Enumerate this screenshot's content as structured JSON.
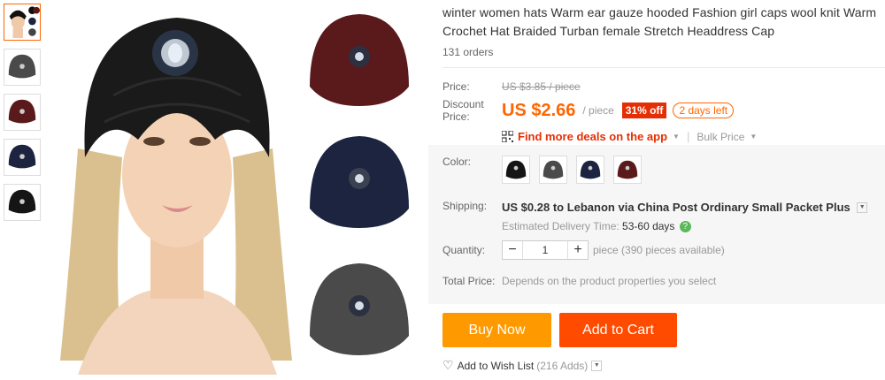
{
  "product": {
    "title": "winter women hats Warm ear gauze hooded Fashion girl caps wool knit Warm Crochet Hat Braided Turban female Stretch Headdress Cap",
    "orders": "131 orders"
  },
  "price": {
    "label": "Price:",
    "original": "US $3.85 / piece",
    "discount_label": "Discount Price:",
    "discount_value": "US $2.66",
    "unit": "/ piece",
    "off_badge": "31% off",
    "days_left": "2 days left",
    "deals_link": "Find more deals on the app",
    "bulk_price": "Bulk Price"
  },
  "color": {
    "label": "Color:",
    "options": [
      "black",
      "gray",
      "navy",
      "burgundy"
    ],
    "hexes": [
      "#151515",
      "#4a4a4a",
      "#1c2440",
      "#5a1a1c"
    ]
  },
  "shipping": {
    "label": "Shipping:",
    "value": "US $0.28 to Lebanon via China Post Ordinary Small Packet Plus",
    "estimate_label": "Estimated Delivery Time:",
    "estimate_value": "53-60 days"
  },
  "quantity": {
    "label": "Quantity:",
    "value": "1",
    "unit_note": "piece (390 pieces available)"
  },
  "total": {
    "label": "Total Price:",
    "note": "Depends on the product properties you select"
  },
  "actions": {
    "buy_now": "Buy Now",
    "add_to_cart": "Add to Cart",
    "wish": "Add to Wish List",
    "wish_count": "(216 Adds)"
  },
  "colors": {
    "accent": "#ff6600",
    "buy": "#ff9900",
    "cart": "#ff4b00",
    "badge": "#e62e04"
  }
}
